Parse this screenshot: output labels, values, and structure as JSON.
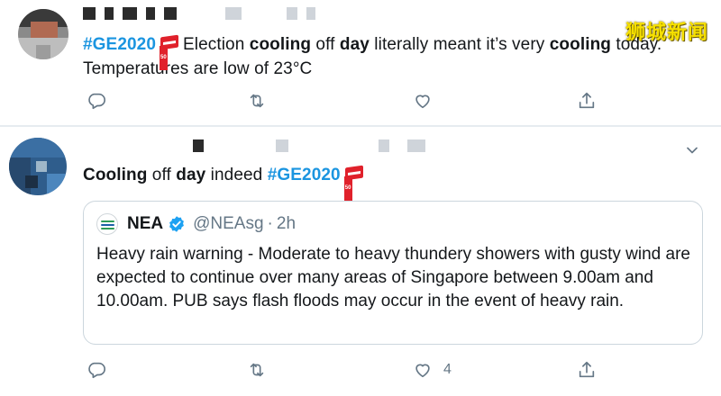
{
  "watermark": "狮城新闻",
  "tweet1": {
    "hashtag": "#GE2020",
    "flag_emoji": "sg50-flag-emoji",
    "text_parts": [
      "Election ",
      "cooling",
      " off ",
      "day",
      " literally meant it’s very ",
      "cooling",
      " today. Temperatures are low of 23°C"
    ],
    "actions": {
      "reply": "",
      "retweet": "",
      "like": "",
      "share": ""
    }
  },
  "tweet2": {
    "text_parts": [
      "Cooling",
      " off ",
      "day",
      " indeed "
    ],
    "hashtag": "#GE2020",
    "flag_emoji": "sg50-flag-emoji",
    "quote": {
      "name": "NEA",
      "handle": "@NEAsg",
      "separator": "·",
      "time": "2h",
      "text": "Heavy rain warning - Moderate to heavy thundery showers with gusty wind are expected to continue over many areas of Singapore between 9.00am and 10.00am. PUB says flash floods may occur in the event of heavy rain."
    },
    "actions": {
      "reply": "",
      "retweet": "",
      "like": "4",
      "share": ""
    }
  },
  "icons": {
    "reply": "reply-icon",
    "retweet": "retweet-icon",
    "like": "heart-icon",
    "share": "share-icon",
    "more": "chevron-down-icon",
    "verified": "verified-badge-icon"
  },
  "colors": {
    "hashtag": "#1b95e0",
    "verified": "#1da1f2",
    "icon_gray": "#657786",
    "border": "#ccd6dd",
    "watermark": "#f6e000"
  }
}
